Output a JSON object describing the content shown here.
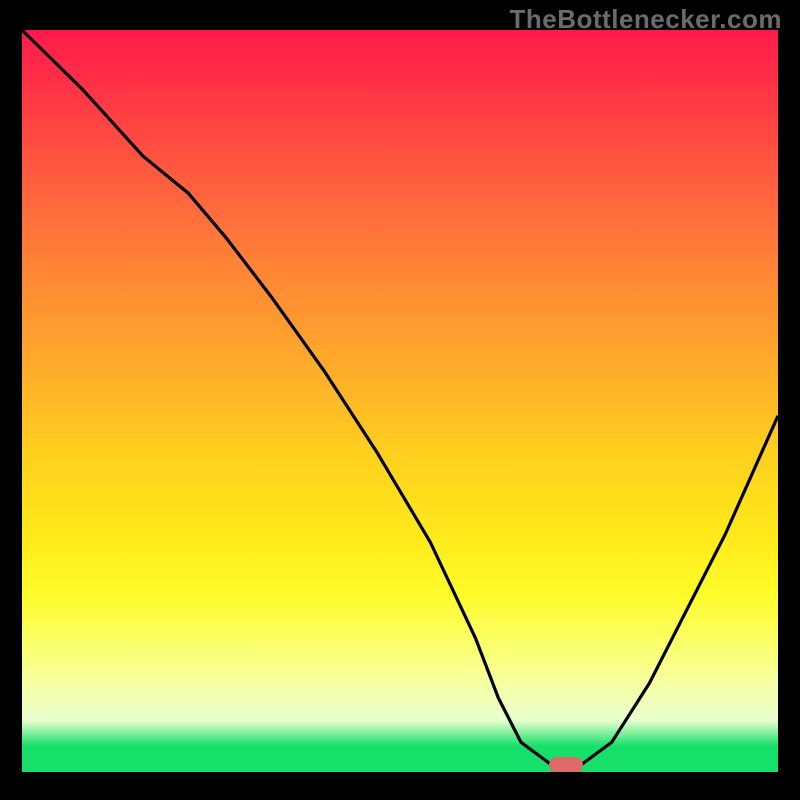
{
  "watermark": "TheBottlenecker.com",
  "chart_data": {
    "type": "line",
    "title": "",
    "xlabel": "",
    "ylabel": "",
    "xlim": [
      0,
      100
    ],
    "ylim": [
      0,
      100
    ],
    "background": "red-yellow-green vertical gradient (high=top=red, low=bottom=green)",
    "series": [
      {
        "name": "bottleneck-curve",
        "x": [
          0,
          8,
          16,
          22,
          27,
          33,
          40,
          47,
          54,
          60,
          63,
          66,
          70,
          74,
          78,
          83,
          88,
          93,
          100
        ],
        "values": [
          100,
          92,
          83,
          78,
          72,
          64,
          54,
          43,
          31,
          18,
          10,
          4,
          1,
          1,
          4,
          12,
          22,
          32,
          48
        ]
      }
    ],
    "marker": {
      "name": "optimal-point",
      "x": 72,
      "y": 1,
      "color": "#e06a6a"
    },
    "colors": {
      "curve": "#000000",
      "frame": "#000000",
      "marker": "#e06a6a",
      "gradient_top": "#ff1a4b",
      "gradient_mid": "#ffe91a",
      "gradient_bottom": "#16e06a"
    }
  }
}
